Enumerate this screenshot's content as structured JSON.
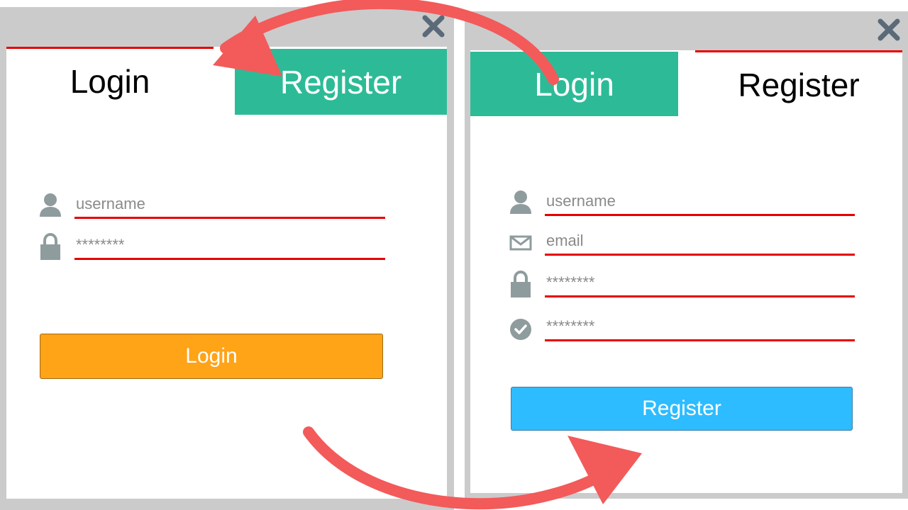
{
  "left_panel": {
    "tabs": {
      "login": "Login",
      "register": "Register"
    },
    "fields": {
      "username": {
        "value": "",
        "placeholder": "username"
      },
      "password": {
        "value": "",
        "placeholder": "********"
      }
    },
    "button": "Login"
  },
  "right_panel": {
    "tabs": {
      "login": "Login",
      "register": "Register"
    },
    "fields": {
      "username": {
        "value": "",
        "placeholder": "username"
      },
      "email": {
        "value": "",
        "placeholder": "email"
      },
      "password": {
        "value": "",
        "placeholder": "********"
      },
      "confirm_password": {
        "value": "",
        "placeholder": "********"
      }
    },
    "button": "Register"
  },
  "icons": {
    "close": "close-icon",
    "user": "user-icon",
    "lock": "lock-icon",
    "mail": "mail-icon",
    "check": "check-circle-icon",
    "arrow": "curved-arrow-icon"
  },
  "colors": {
    "tab_inactive": "#2dbb97",
    "underline": "#e60000",
    "login_button": "#ffa317",
    "register_button": "#2dbcff",
    "arrow": "#f35a5a",
    "chrome": "#cbcbcb",
    "icon": "#8f9c9e"
  }
}
